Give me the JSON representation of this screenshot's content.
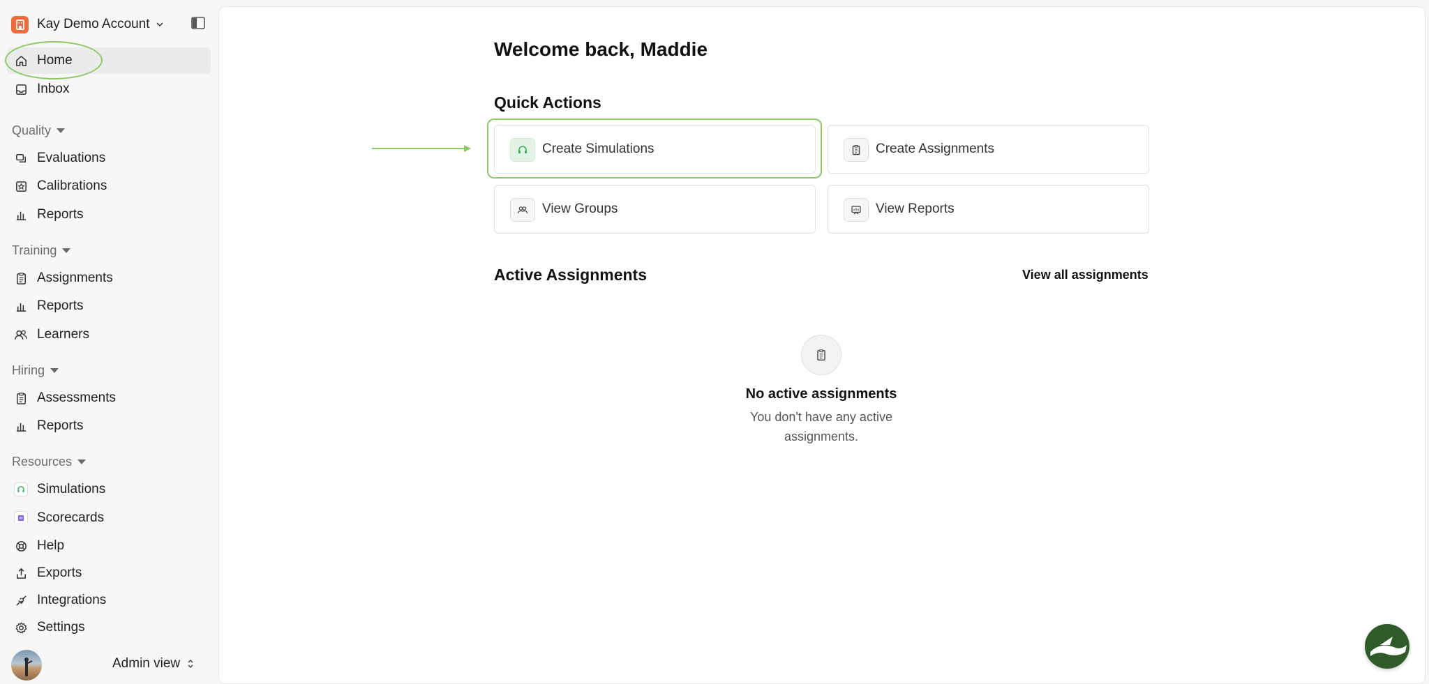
{
  "account": {
    "name": "Kay Demo Account"
  },
  "sidebar": {
    "top": [
      {
        "label": "Home",
        "icon": "home-icon"
      },
      {
        "label": "Inbox",
        "icon": "inbox-icon"
      }
    ],
    "quality": {
      "title": "Quality",
      "items": [
        {
          "label": "Evaluations",
          "icon": "evaluations-icon"
        },
        {
          "label": "Calibrations",
          "icon": "calibrations-icon"
        },
        {
          "label": "Reports",
          "icon": "bar-chart-icon"
        }
      ]
    },
    "training": {
      "title": "Training",
      "items": [
        {
          "label": "Assignments",
          "icon": "clipboard-icon"
        },
        {
          "label": "Reports",
          "icon": "bar-chart-icon"
        },
        {
          "label": "Learners",
          "icon": "users-icon"
        }
      ]
    },
    "hiring": {
      "title": "Hiring",
      "items": [
        {
          "label": "Assessments",
          "icon": "clipboard-icon"
        },
        {
          "label": "Reports",
          "icon": "bar-chart-icon"
        }
      ]
    },
    "resources": {
      "title": "Resources",
      "items": [
        {
          "label": "Simulations",
          "icon": "headset-icon"
        },
        {
          "label": "Scorecards",
          "icon": "scorecard-icon"
        }
      ]
    },
    "bottom": [
      {
        "label": "Help",
        "icon": "lifebuoy-icon"
      },
      {
        "label": "Exports",
        "icon": "export-icon"
      },
      {
        "label": "Integrations",
        "icon": "plug-icon"
      },
      {
        "label": "Settings",
        "icon": "gear-icon"
      }
    ],
    "user": {
      "view_label": "Admin view"
    }
  },
  "main": {
    "welcome": "Welcome back, Maddie",
    "quick_actions": {
      "title": "Quick Actions",
      "items": [
        {
          "label": "Create Simulations",
          "icon": "headset-icon"
        },
        {
          "label": "Create Assignments",
          "icon": "clipboard-icon"
        },
        {
          "label": "View Groups",
          "icon": "users-icon"
        },
        {
          "label": "View Reports",
          "icon": "report-icon"
        }
      ]
    },
    "active_assignments": {
      "title": "Active Assignments",
      "view_all": "View all assignments",
      "empty_title": "No active assignments",
      "empty_text": "You don't have any active assignments."
    }
  },
  "colors": {
    "accent_green": "#8cc965",
    "brand_orange": "#f06a3c",
    "fab_green": "#2f5a2a"
  }
}
